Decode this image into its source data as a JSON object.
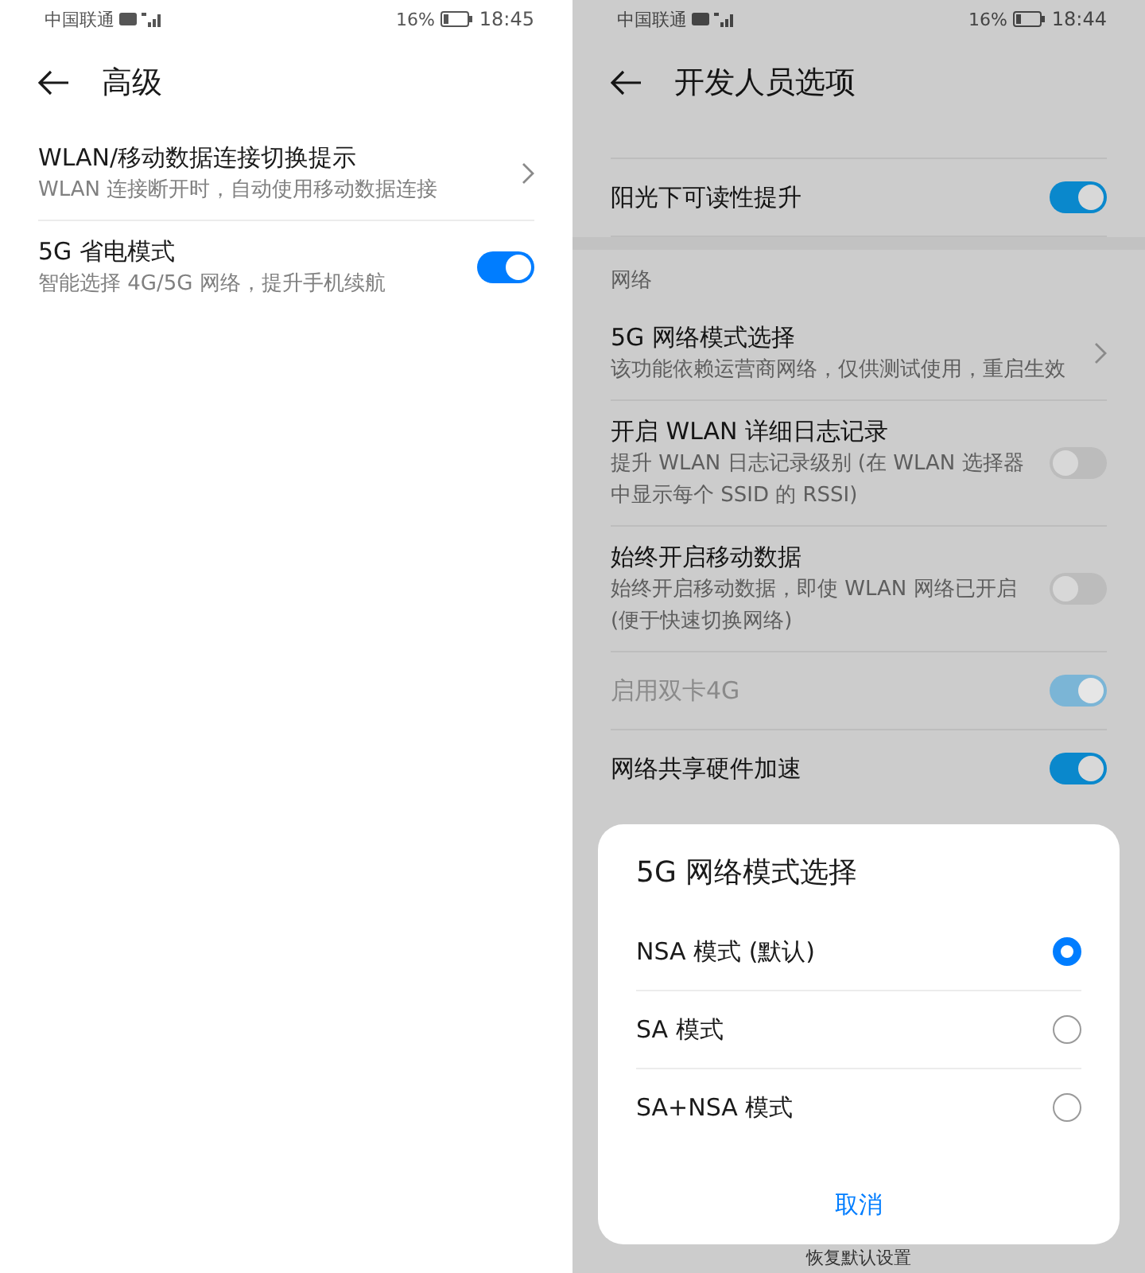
{
  "screens": [
    {
      "status_bar": {
        "carrier": "中国联通",
        "battery": "16%",
        "time": "18:45"
      },
      "title": "高级",
      "dimmed": false,
      "items": [
        {
          "kind": "link",
          "title": "WLAN/移动数据连接切换提示",
          "subtitle": "WLAN 连接断开时，自动使用移动数据连接"
        },
        {
          "kind": "switch",
          "title": "5G 省电模式",
          "subtitle": "智能选择 4G/5G 网络，提升手机续航",
          "on": true,
          "disabled": false
        }
      ]
    },
    {
      "status_bar": {
        "carrier": "中国联通",
        "battery": "16%",
        "time": "18:44"
      },
      "title": "开发人员选项",
      "dimmed": true,
      "items": [
        {
          "kind": "switch",
          "title": "阳光下可读性提升",
          "on": true,
          "disabled": false
        },
        {
          "kind": "section",
          "title": "网络"
        },
        {
          "kind": "link",
          "title": "5G 网络模式选择",
          "subtitle": "该功能依赖运营商网络，仅供测试使用，重启生效"
        },
        {
          "kind": "switch",
          "title": "开启 WLAN 详细日志记录",
          "subtitle": "提升 WLAN 日志记录级别 (在 WLAN 选择器中显示每个 SSID 的 RSSI)",
          "on": false,
          "disabled": false
        },
        {
          "kind": "switch",
          "title": "始终开启移动数据",
          "subtitle": "始终开启移动数据，即使 WLAN 网络已开启 (便于快速切换网络)",
          "on": false,
          "disabled": false
        },
        {
          "kind": "switch",
          "title": "启用双卡4G",
          "on": true,
          "disabled": true
        },
        {
          "kind": "switch",
          "title": "网络共享硬件加速",
          "on": true,
          "disabled": false
        }
      ],
      "footer": "恢复默认设置",
      "dialog": {
        "title": "5G 网络模式选择",
        "options": [
          {
            "label": "NSA 模式 (默认)",
            "selected": true
          },
          {
            "label": "SA 模式",
            "selected": false
          },
          {
            "label": "SA+NSA 模式",
            "selected": false
          }
        ],
        "cancel": "取消"
      }
    }
  ]
}
